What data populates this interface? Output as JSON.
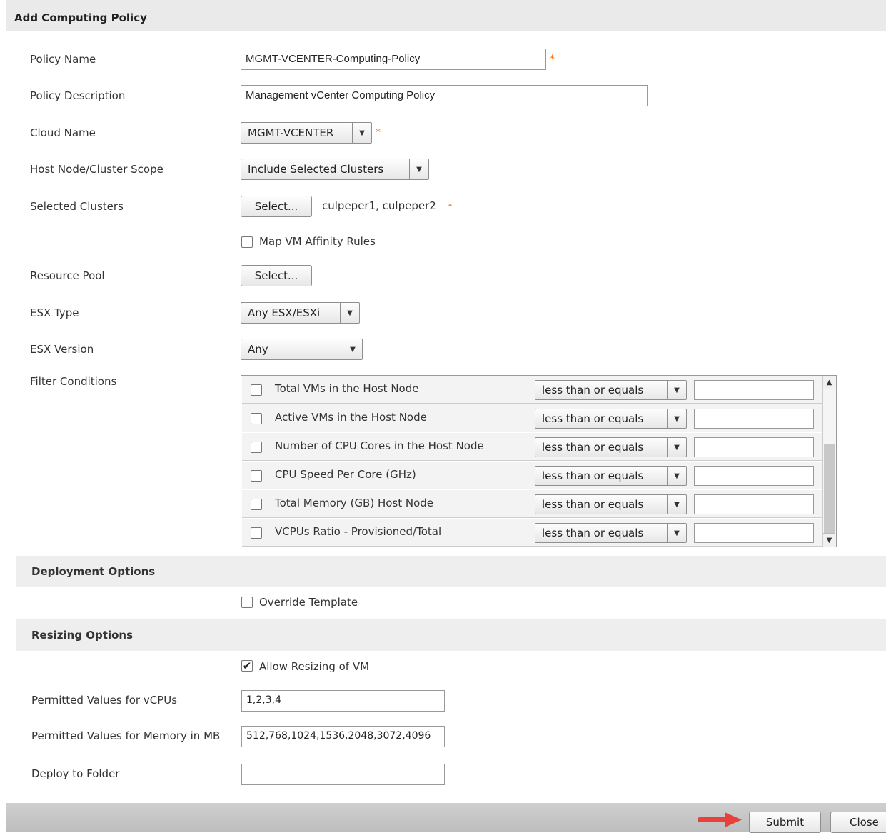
{
  "dialog": {
    "title": "Add Computing Policy"
  },
  "fields": {
    "policy_name": {
      "label": "Policy Name",
      "value": "MGMT-VCENTER-Computing-Policy",
      "required": "*"
    },
    "policy_description": {
      "label": "Policy Description",
      "value": "Management vCenter Computing Policy"
    },
    "cloud_name": {
      "label": "Cloud Name",
      "value": "MGMT-VCENTER",
      "required": "*"
    },
    "host_scope": {
      "label": "Host Node/Cluster Scope",
      "value": "Include Selected Clusters"
    },
    "selected_clusters": {
      "label": "Selected Clusters",
      "button": "Select...",
      "value": "culpeper1, culpeper2",
      "required": "*"
    },
    "map_vm_affinity": {
      "label": "Map VM Affinity Rules",
      "checked": false
    },
    "resource_pool": {
      "label": "Resource Pool",
      "button": "Select..."
    },
    "esx_type": {
      "label": "ESX Type",
      "value": "Any ESX/ESXi"
    },
    "esx_version": {
      "label": "ESX Version",
      "value": "Any"
    },
    "filter_conditions": {
      "label": "Filter Conditions",
      "rows": [
        {
          "label": "Total VMs in the Host Node",
          "operator": "less than or equals",
          "value": ""
        },
        {
          "label": "Active VMs in the Host Node",
          "operator": "less than or equals",
          "value": ""
        },
        {
          "label": "Number of CPU Cores in the Host Node",
          "operator": "less than or equals",
          "value": ""
        },
        {
          "label": "CPU Speed Per Core (GHz)",
          "operator": "less than or equals",
          "value": ""
        },
        {
          "label": "Total Memory (GB) Host Node",
          "operator": "less than or equals",
          "value": ""
        },
        {
          "label": "VCPUs Ratio - Provisioned/Total",
          "operator": "less than or equals",
          "value": ""
        }
      ]
    }
  },
  "deployment": {
    "title": "Deployment Options",
    "override_template": {
      "label": "Override Template",
      "checked": false
    }
  },
  "resizing": {
    "title": "Resizing Options",
    "allow_resizing": {
      "label": "Allow Resizing of VM",
      "checked": true,
      "check_glyph": "✔"
    },
    "vcpus": {
      "label": "Permitted Values for vCPUs",
      "value": "1,2,3,4"
    },
    "memory": {
      "label": "Permitted Values for Memory in MB",
      "value": "512,768,1024,1536,2048,3072,4096"
    },
    "folder": {
      "label": "Deploy to Folder",
      "value": ""
    }
  },
  "footer": {
    "submit": "Submit",
    "close": "Close",
    "arrow_color": "#e8413c"
  },
  "icons": {
    "dropdown": "chevron-down-icon",
    "scroll_up": "scroll-up-icon",
    "scroll_down": "scroll-down-icon",
    "pointer": "red-arrow-icon"
  }
}
